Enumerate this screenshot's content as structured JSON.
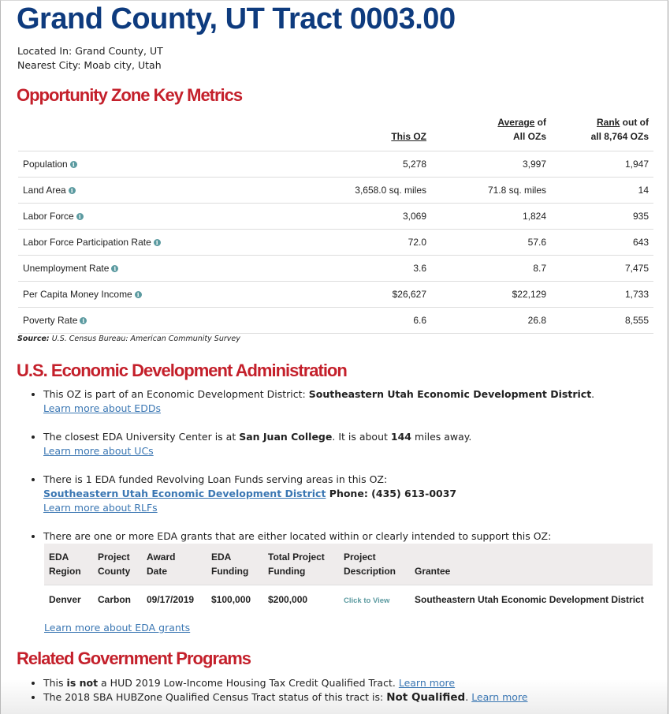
{
  "header": {
    "title": "Grand County, UT Tract 0003.00",
    "located_in": "Located In: Grand County, UT",
    "nearest_city": "Nearest City: Moab city, Utah"
  },
  "metrics": {
    "heading": "Opportunity Zone Key Metrics",
    "columns": {
      "this_oz": "This OZ",
      "avg_u": "Average",
      "avg_rest": " of",
      "avg_line2": "All OZs",
      "rank_u": "Rank",
      "rank_rest": " out of",
      "rank_line2": "all 8,764 OZs"
    },
    "rows": [
      {
        "label": "Population",
        "this_oz": "5,278",
        "average": "3,997",
        "rank": "1,947"
      },
      {
        "label": "Land Area",
        "this_oz": "3,658.0 sq. miles",
        "average": "71.8 sq. miles",
        "rank": "14"
      },
      {
        "label": "Labor Force",
        "this_oz": "3,069",
        "average": "1,824",
        "rank": "935"
      },
      {
        "label": "Labor Force Participation Rate",
        "this_oz": "72.0",
        "average": "57.6",
        "rank": "643"
      },
      {
        "label": "Unemployment Rate",
        "this_oz": "3.6",
        "average": "8.7",
        "rank": "7,475"
      },
      {
        "label": "Per Capita Money Income",
        "this_oz": "$26,627",
        "average": "$22,129",
        "rank": "1,733"
      },
      {
        "label": "Poverty Rate",
        "this_oz": "6.6",
        "average": "26.8",
        "rank": "8,555"
      }
    ],
    "info_icon": "i",
    "source_label": "Source:",
    "source_text": " U.S. Census Bureau: American Community Survey"
  },
  "eda": {
    "heading": "U.S. Economic Development Administration",
    "edd": {
      "text": "This OZ is part of an Economic Development District: ",
      "bold": "Southeastern Utah Economic Development District",
      "suffix": ".",
      "link": "Learn more about EDDs"
    },
    "uc": {
      "text1": "The closest EDA University Center is at ",
      "bold1": "San Juan College",
      "text2": ". It is about ",
      "bold2": "144",
      "text3": " miles away.",
      "link": "Learn more about UCs"
    },
    "rlf": {
      "text": "There is 1 EDA funded Revolving Loan Funds serving areas in this OZ:",
      "org_link": "Southeastern Utah Economic Development District",
      "phone": " Phone: (435) 613-0037",
      "link": "Learn more about RLFs"
    },
    "grants": {
      "text": "There are one or more EDA grants that are either located within or clearly intended to support this OZ:",
      "columns": [
        [
          "EDA",
          "Region"
        ],
        [
          "Project",
          "County"
        ],
        [
          "Award",
          "Date"
        ],
        [
          "EDA",
          "Funding"
        ],
        [
          "Total Project",
          "Funding"
        ],
        [
          "Project",
          "Description"
        ],
        [
          "",
          "Grantee"
        ]
      ],
      "rows": [
        {
          "region": "Denver",
          "county": "Carbon",
          "date": "09/17/2019",
          "eda_funding": "$100,000",
          "total_funding": "$200,000",
          "description": "Click to View",
          "grantee": "Southeastern Utah Economic Development District"
        }
      ],
      "link": "Learn more about EDA grants"
    }
  },
  "related": {
    "heading": "Related Government Programs",
    "hud": {
      "text1": "This ",
      "bold": "is not",
      "text2": " a HUD 2019 Low-Income Housing Tax Credit Qualified Tract. ",
      "link": "Learn more"
    },
    "sba": {
      "text1": "The 2018 SBA HUBZone Qualified Census Tract status of this tract is: ",
      "bold": "Not Qualified",
      "text2": ". ",
      "link": "Learn more"
    }
  }
}
